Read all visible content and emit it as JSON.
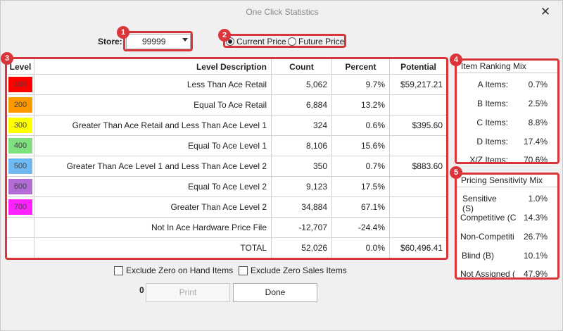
{
  "window": {
    "title": "One Click Statistics",
    "close": "✕"
  },
  "store": {
    "label": "Store:",
    "value": "99999"
  },
  "price_mode": {
    "current": "Current Price",
    "future": "Future Price",
    "selected": "current"
  },
  "badges": [
    "1",
    "2",
    "3",
    "4",
    "5"
  ],
  "levels_table": {
    "headers": {
      "level": "Level",
      "description": "Level Description",
      "count": "Count",
      "percent": "Percent",
      "potential": "Potential"
    },
    "rows": [
      {
        "level": "100",
        "color": "#ff0000",
        "description": "Less Than Ace Retail",
        "count": "5,062",
        "percent": "9.7%",
        "potential": "$59,217.21"
      },
      {
        "level": "200",
        "color": "#ff9900",
        "description": "Equal To Ace Retail",
        "count": "6,884",
        "percent": "13.2%",
        "potential": ""
      },
      {
        "level": "300",
        "color": "#ffff00",
        "description": "Greater Than Ace Retail and Less Than Ace Level 1",
        "count": "324",
        "percent": "0.6%",
        "potential": "$395.60"
      },
      {
        "level": "400",
        "color": "#7fe07f",
        "description": "Equal To Ace Level 1",
        "count": "8,106",
        "percent": "15.6%",
        "potential": ""
      },
      {
        "level": "500",
        "color": "#6fb9f2",
        "description": "Greater Than Ace Level 1 and Less Than Ace Level 2",
        "count": "350",
        "percent": "0.7%",
        "potential": "$883.60"
      },
      {
        "level": "600",
        "color": "#b36bd6",
        "description": "Equal To Ace Level 2",
        "count": "9,123",
        "percent": "17.5%",
        "potential": ""
      },
      {
        "level": "700",
        "color": "#ff22ff",
        "description": "Greater Than Ace Level 2",
        "count": "34,884",
        "percent": "67.1%",
        "potential": ""
      },
      {
        "level": "",
        "color": "",
        "description": "Not In Ace Hardware Price File",
        "count": "-12,707",
        "percent": "-24.4%",
        "potential": ""
      },
      {
        "level": "",
        "color": "",
        "description": "TOTAL",
        "count": "52,026",
        "percent": "0.0%",
        "potential": "$60,496.41"
      }
    ]
  },
  "filters": {
    "exclude_zero_on_hand": "Exclude Zero on Hand Items",
    "exclude_zero_sales": "Exclude Zero Sales Items"
  },
  "footer": {
    "count": "0",
    "print": "Print",
    "done": "Done"
  },
  "item_ranking": {
    "title": "Item Ranking Mix",
    "rows": [
      {
        "label": "A Items:",
        "value": "0.7%"
      },
      {
        "label": "B Items:",
        "value": "2.5%"
      },
      {
        "label": "C Items:",
        "value": "8.8%"
      },
      {
        "label": "D Items:",
        "value": "17.4%"
      },
      {
        "label": "X/Z Items:",
        "value": "70.6%"
      }
    ]
  },
  "pricing_sensitivity": {
    "title": "Pricing Sensitivity Mix",
    "rows": [
      {
        "label": "Sensitive (S)",
        "value": "1.0%"
      },
      {
        "label": "Competitive (C",
        "value": "14.3%"
      },
      {
        "label": "Non-Competiti",
        "value": "26.7%"
      },
      {
        "label": "Blind (B)",
        "value": "10.1%"
      },
      {
        "label": "Not Assigned (",
        "value": "47.9%"
      }
    ]
  }
}
